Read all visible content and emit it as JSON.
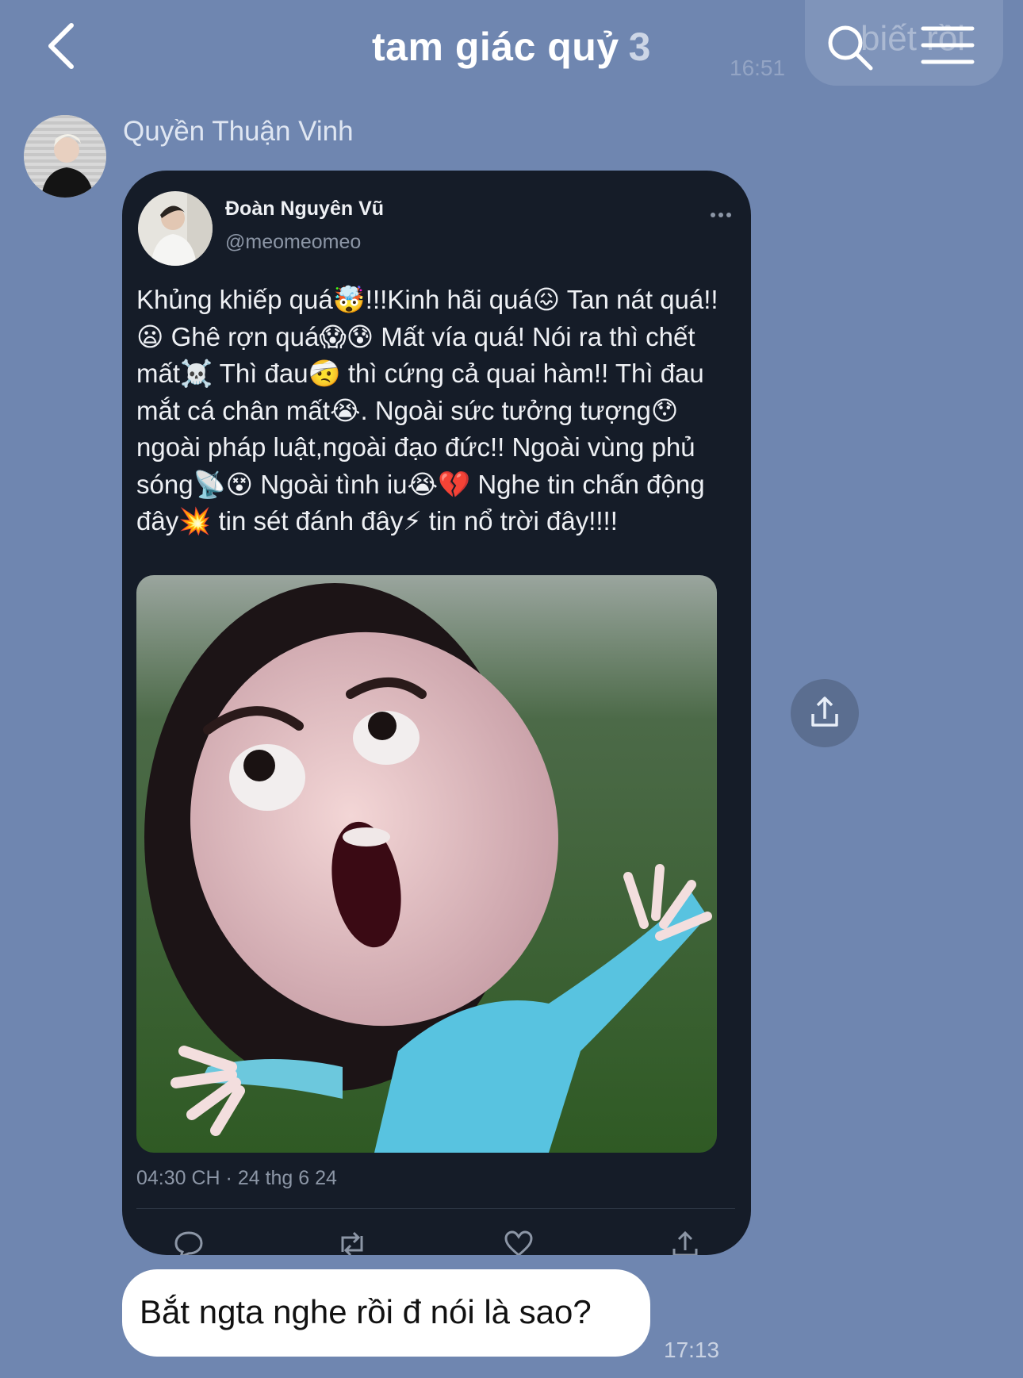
{
  "header": {
    "title": "tam giác quỷ",
    "member_count": "3",
    "ghost_text": "biết rồi",
    "ghost_time": "16:51"
  },
  "message": {
    "sender_name": "Quyền Thuận Vinh",
    "tweet": {
      "author_name": "Đoàn Nguyên Vũ",
      "author_handle": "@meomeomeo",
      "text": "Khủng khiếp quá🤯!!!Kinh hãi quá😖 Tan nát quá!!\n😦 Ghê rợn quá😱😰 Mất vía quá! Nói ra thì chết\nmất☠️ Thì đau🤕 thì cứng cả quai hàm!! Thì đau\nmắt cá chân mất😭. Ngoài sức tưởng tượng😯\nngoài pháp luật,ngoài đạo đức!! Ngoài vùng phủ\nsóng📡😵 Ngoài tình iu😭💔 Nghe tin chấn động\nđây💥 tin sét đánh đây⚡ tin nổ trời đây!!!!",
      "timestamp": "04:30 CH · 24 thg 6 24",
      "actions": [
        "reply-icon",
        "retweet-icon",
        "like-icon",
        "share-icon"
      ]
    }
  },
  "reply": {
    "text": "Bắt ngta nghe rồi đ nói là sao?",
    "time": "17:13"
  },
  "colors": {
    "background": "#6f86b0",
    "card": "#151c28",
    "bubble": "#ffffff",
    "muted": "#8c96a6"
  }
}
